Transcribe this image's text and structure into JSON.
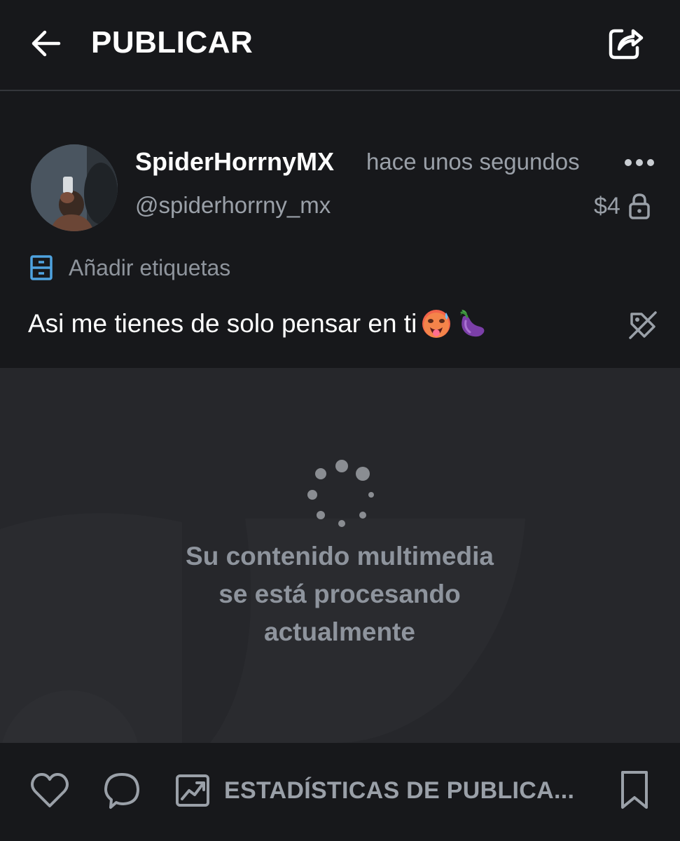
{
  "header": {
    "title": "PUBLICAR",
    "back_icon": "arrow-left-icon",
    "share_icon": "share-icon"
  },
  "post": {
    "author_name": "SpiderHorrnyMX",
    "time": "hace unos segundos",
    "handle": "@spiderhorrny_mx",
    "price": "$4",
    "tags_label": "Añadir etiquetas",
    "text": "Asi me tienes de solo pensar en ti",
    "emojis": [
      "hot-face-emoji",
      "eggplant-emoji"
    ]
  },
  "media": {
    "processing_lines": [
      "Su contenido multimedia",
      "se está procesando",
      "actualmente"
    ]
  },
  "footer": {
    "stats_label": "ESTADÍSTICAS DE PUBLICA..."
  },
  "colors": {
    "background": "#17181b",
    "media_background": "#26272b",
    "muted_text": "#9aa0a8",
    "tag_icon": "#4fa3e0"
  }
}
